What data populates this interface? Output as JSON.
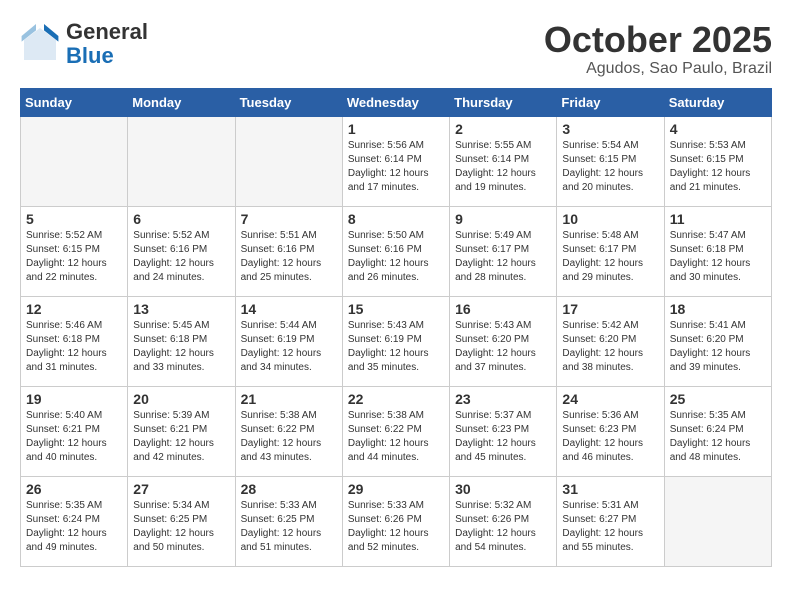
{
  "logo": {
    "general": "General",
    "blue": "Blue"
  },
  "title": "October 2025",
  "location": "Agudos, Sao Paulo, Brazil",
  "weekdays": [
    "Sunday",
    "Monday",
    "Tuesday",
    "Wednesday",
    "Thursday",
    "Friday",
    "Saturday"
  ],
  "weeks": [
    [
      {
        "day": "",
        "info": "",
        "empty": true
      },
      {
        "day": "",
        "info": "",
        "empty": true
      },
      {
        "day": "",
        "info": "",
        "empty": true
      },
      {
        "day": "1",
        "info": "Sunrise: 5:56 AM\nSunset: 6:14 PM\nDaylight: 12 hours and 17 minutes."
      },
      {
        "day": "2",
        "info": "Sunrise: 5:55 AM\nSunset: 6:14 PM\nDaylight: 12 hours and 19 minutes."
      },
      {
        "day": "3",
        "info": "Sunrise: 5:54 AM\nSunset: 6:15 PM\nDaylight: 12 hours and 20 minutes."
      },
      {
        "day": "4",
        "info": "Sunrise: 5:53 AM\nSunset: 6:15 PM\nDaylight: 12 hours and 21 minutes."
      }
    ],
    [
      {
        "day": "5",
        "info": "Sunrise: 5:52 AM\nSunset: 6:15 PM\nDaylight: 12 hours and 22 minutes."
      },
      {
        "day": "6",
        "info": "Sunrise: 5:52 AM\nSunset: 6:16 PM\nDaylight: 12 hours and 24 minutes."
      },
      {
        "day": "7",
        "info": "Sunrise: 5:51 AM\nSunset: 6:16 PM\nDaylight: 12 hours and 25 minutes."
      },
      {
        "day": "8",
        "info": "Sunrise: 5:50 AM\nSunset: 6:16 PM\nDaylight: 12 hours and 26 minutes."
      },
      {
        "day": "9",
        "info": "Sunrise: 5:49 AM\nSunset: 6:17 PM\nDaylight: 12 hours and 28 minutes."
      },
      {
        "day": "10",
        "info": "Sunrise: 5:48 AM\nSunset: 6:17 PM\nDaylight: 12 hours and 29 minutes."
      },
      {
        "day": "11",
        "info": "Sunrise: 5:47 AM\nSunset: 6:18 PM\nDaylight: 12 hours and 30 minutes."
      }
    ],
    [
      {
        "day": "12",
        "info": "Sunrise: 5:46 AM\nSunset: 6:18 PM\nDaylight: 12 hours and 31 minutes."
      },
      {
        "day": "13",
        "info": "Sunrise: 5:45 AM\nSunset: 6:18 PM\nDaylight: 12 hours and 33 minutes."
      },
      {
        "day": "14",
        "info": "Sunrise: 5:44 AM\nSunset: 6:19 PM\nDaylight: 12 hours and 34 minutes."
      },
      {
        "day": "15",
        "info": "Sunrise: 5:43 AM\nSunset: 6:19 PM\nDaylight: 12 hours and 35 minutes."
      },
      {
        "day": "16",
        "info": "Sunrise: 5:43 AM\nSunset: 6:20 PM\nDaylight: 12 hours and 37 minutes."
      },
      {
        "day": "17",
        "info": "Sunrise: 5:42 AM\nSunset: 6:20 PM\nDaylight: 12 hours and 38 minutes."
      },
      {
        "day": "18",
        "info": "Sunrise: 5:41 AM\nSunset: 6:20 PM\nDaylight: 12 hours and 39 minutes."
      }
    ],
    [
      {
        "day": "19",
        "info": "Sunrise: 5:40 AM\nSunset: 6:21 PM\nDaylight: 12 hours and 40 minutes."
      },
      {
        "day": "20",
        "info": "Sunrise: 5:39 AM\nSunset: 6:21 PM\nDaylight: 12 hours and 42 minutes."
      },
      {
        "day": "21",
        "info": "Sunrise: 5:38 AM\nSunset: 6:22 PM\nDaylight: 12 hours and 43 minutes."
      },
      {
        "day": "22",
        "info": "Sunrise: 5:38 AM\nSunset: 6:22 PM\nDaylight: 12 hours and 44 minutes."
      },
      {
        "day": "23",
        "info": "Sunrise: 5:37 AM\nSunset: 6:23 PM\nDaylight: 12 hours and 45 minutes."
      },
      {
        "day": "24",
        "info": "Sunrise: 5:36 AM\nSunset: 6:23 PM\nDaylight: 12 hours and 46 minutes."
      },
      {
        "day": "25",
        "info": "Sunrise: 5:35 AM\nSunset: 6:24 PM\nDaylight: 12 hours and 48 minutes."
      }
    ],
    [
      {
        "day": "26",
        "info": "Sunrise: 5:35 AM\nSunset: 6:24 PM\nDaylight: 12 hours and 49 minutes."
      },
      {
        "day": "27",
        "info": "Sunrise: 5:34 AM\nSunset: 6:25 PM\nDaylight: 12 hours and 50 minutes."
      },
      {
        "day": "28",
        "info": "Sunrise: 5:33 AM\nSunset: 6:25 PM\nDaylight: 12 hours and 51 minutes."
      },
      {
        "day": "29",
        "info": "Sunrise: 5:33 AM\nSunset: 6:26 PM\nDaylight: 12 hours and 52 minutes."
      },
      {
        "day": "30",
        "info": "Sunrise: 5:32 AM\nSunset: 6:26 PM\nDaylight: 12 hours and 54 minutes."
      },
      {
        "day": "31",
        "info": "Sunrise: 5:31 AM\nSunset: 6:27 PM\nDaylight: 12 hours and 55 minutes."
      },
      {
        "day": "",
        "info": "",
        "empty": true
      }
    ]
  ]
}
